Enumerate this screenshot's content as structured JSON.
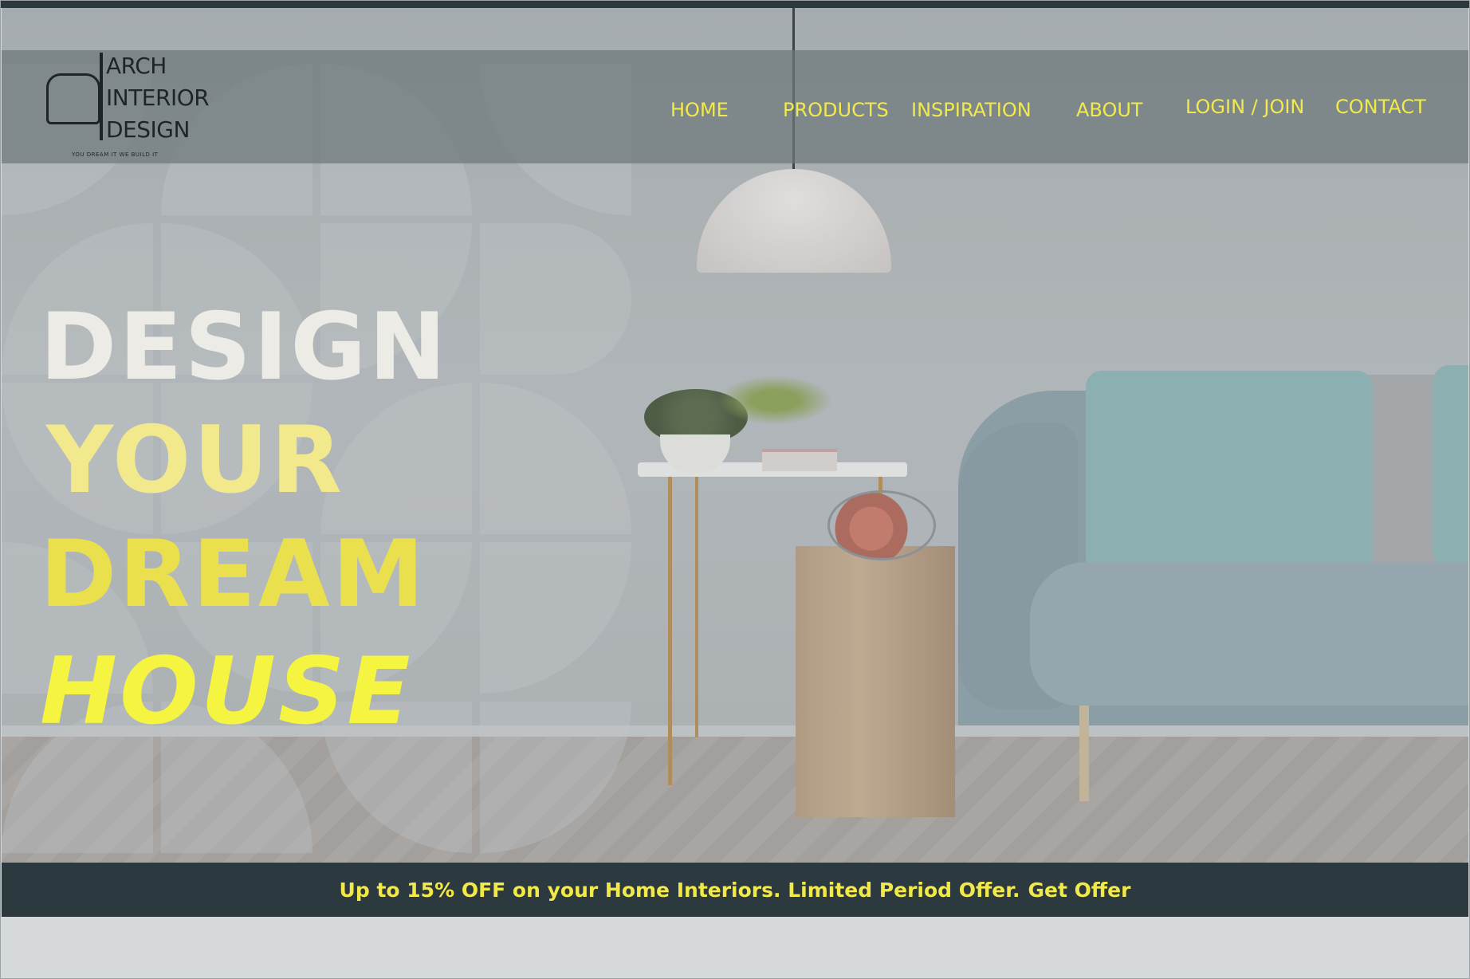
{
  "brand": {
    "line1": "ARCH",
    "line2": "INTERIOR",
    "line3": "DESIGN",
    "tagline": "YOU DREAM IT WE BUILD IT"
  },
  "nav": {
    "items": [
      {
        "label": "HOME"
      },
      {
        "label": "PRODUCTS"
      },
      {
        "label": "INSPIRATION"
      },
      {
        "label": "ABOUT"
      },
      {
        "label": "LOGIN / JOIN"
      },
      {
        "label": "CONTACT"
      }
    ]
  },
  "hero": {
    "line1": "DESIGN",
    "line2": "YOUR",
    "line3": "DREAM",
    "line4": "HOUSE"
  },
  "promo": {
    "text": "Up to 15% OFF on your Home Interiors. Limited Period Offer.",
    "cta": "Get Offer"
  },
  "colors": {
    "accent": "#f1ea4a",
    "dark": "#2c393f",
    "headline_white": "#ecebe5"
  }
}
